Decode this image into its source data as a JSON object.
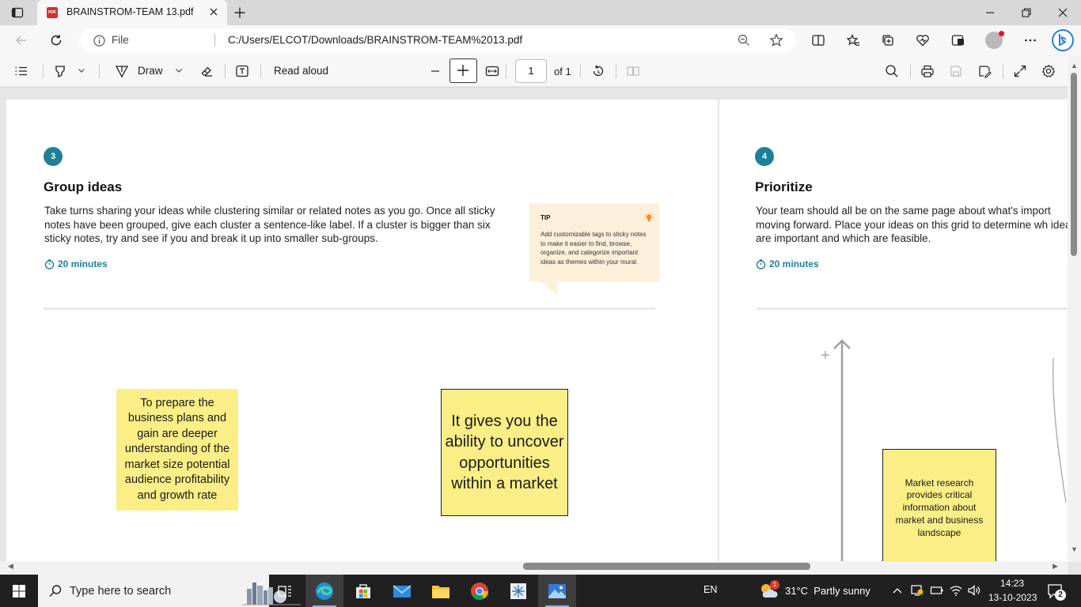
{
  "browser": {
    "tab_title": "BRAINSTROM-TEAM 13.pdf",
    "file_label": "File",
    "url": "C:/Users/ELCOT/Downloads/BRAINSTROM-TEAM%2013.pdf"
  },
  "pdf_toolbar": {
    "draw_label": "Draw",
    "read_aloud_label": "Read aloud",
    "page_number": "1",
    "page_total": "of 1"
  },
  "page": {
    "step3": {
      "number": "3",
      "title": "Group ideas",
      "description": "Take turns sharing your ideas while clustering similar or related notes as you go. Once all sticky notes have been grouped, give each cluster a sentence-like label. If a cluster is bigger than six sticky notes, try and see if you and break it up into smaller sub-groups.",
      "duration": "20 minutes"
    },
    "tip": {
      "title": "TIP",
      "body": "Add customizable tags to sticky notes to make it easier to find, browse, organize, and categorize important ideas as themes within your mural."
    },
    "sticky_notes": [
      "To prepare the business plans and gain are deeper understanding of the market size potential audience profitability and growth rate",
      "It gives you the ability to uncover opportunities within a market",
      "Market research provides critical information about market and business landscape"
    ],
    "step4": {
      "number": "4",
      "title": "Prioritize",
      "description": "Your team should all be on the same page about what's import moving forward. Place your ideas on this grid to determine wh ideas are important and which are feasible.",
      "duration": "20 minutes",
      "axis_plus": "+"
    }
  },
  "taskbar": {
    "search_placeholder": "Type here to search",
    "language": "EN",
    "weather": "31°C  Partly sunny",
    "weather_badge": "1",
    "time": "14:23",
    "date": "13-10-2023",
    "notification_count": "2"
  },
  "colors": {
    "accent_teal": "#1d8096",
    "sticky_yellow": "#fbee86",
    "tip_background": "#fcf0db"
  }
}
